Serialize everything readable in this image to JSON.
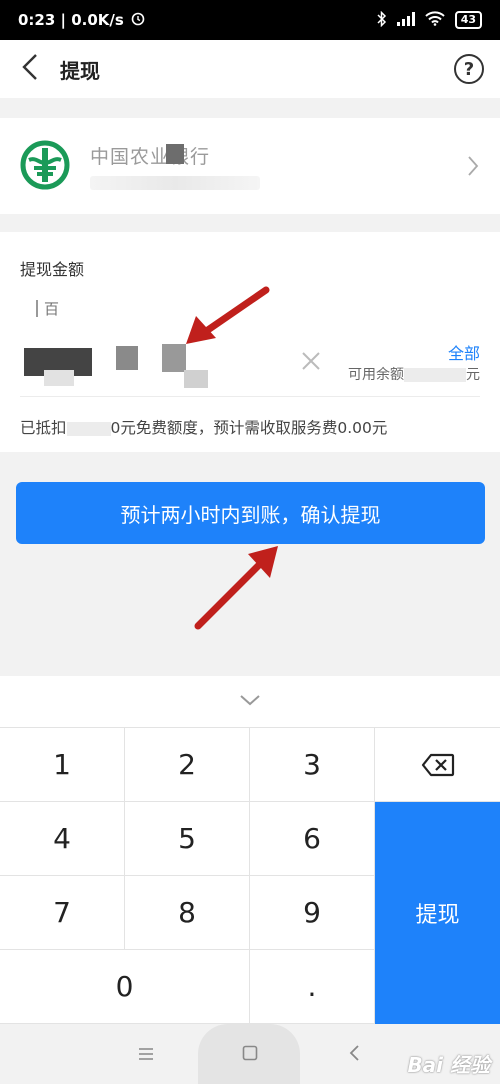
{
  "status_bar": {
    "time_speed": "0:23 | 0.0K/s",
    "battery": "43"
  },
  "nav": {
    "title": "提现",
    "help_glyph": "?"
  },
  "bank": {
    "name": "中国农业银行"
  },
  "amount": {
    "label": "提现金额",
    "unit_hint": "百",
    "all_label": "全部",
    "available_prefix": "可用余额",
    "available_tail": "元",
    "fee_prefix": "已抵扣",
    "fee_mid": "0元免费额度，预计需收取服务费0.00元"
  },
  "confirm_button": {
    "label": "预计两小时内到账，确认提现"
  },
  "keyboard": {
    "keys": [
      "1",
      "2",
      "3",
      "4",
      "5",
      "6",
      "7",
      "8",
      "9",
      "0",
      "."
    ],
    "submit_label": "提现"
  },
  "watermark": "Bai 经验",
  "colors": {
    "accent": "#1e82fa",
    "arrow": "#c0201c",
    "bank_green": "#1b9a58"
  },
  "icons": {
    "back": "chevron-left-icon",
    "help": "question-circle-icon",
    "bank": "abc-bank-logo-icon",
    "chevron": "chevron-right-icon",
    "clear": "close-icon",
    "collapse": "chevron-down-icon",
    "delete": "backspace-icon"
  }
}
